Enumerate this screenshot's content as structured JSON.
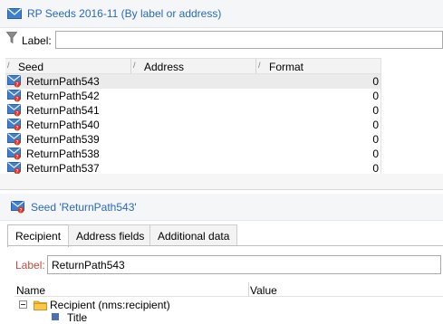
{
  "top_panel": {
    "title": "RP Seeds 2016-11 (By label or address)",
    "filter_label": "Label:",
    "filter_value": "",
    "columns": [
      "Seed",
      "Address",
      "Format"
    ],
    "rows": [
      {
        "name": "ReturnPath543",
        "address": "",
        "format": "0"
      },
      {
        "name": "ReturnPath542",
        "address": "",
        "format": "0"
      },
      {
        "name": "ReturnPath541",
        "address": "",
        "format": "0"
      },
      {
        "name": "ReturnPath540",
        "address": "",
        "format": "0"
      },
      {
        "name": "ReturnPath539",
        "address": "",
        "format": "0"
      },
      {
        "name": "ReturnPath538",
        "address": "",
        "format": "0"
      },
      {
        "name": "ReturnPath537",
        "address": "",
        "format": "0"
      }
    ]
  },
  "bottom_panel": {
    "title": "Seed 'ReturnPath543'",
    "tabs": [
      "Recipient",
      "Address fields",
      "Additional data"
    ],
    "label_caption": "Label:",
    "label_value": "ReturnPath543",
    "tree_columns": [
      "Name",
      "Value"
    ],
    "tree_root": "Recipient (nms:recipient)",
    "tree_child": "Title"
  },
  "colors": {
    "title_blue": "#2a6ab8",
    "label_red": "#c24a3c",
    "selection": "#ebebeb"
  },
  "icons": {
    "seed_row": "seed-envelope-icon",
    "filter": "filter-funnel-icon",
    "folder": "folder-icon"
  }
}
